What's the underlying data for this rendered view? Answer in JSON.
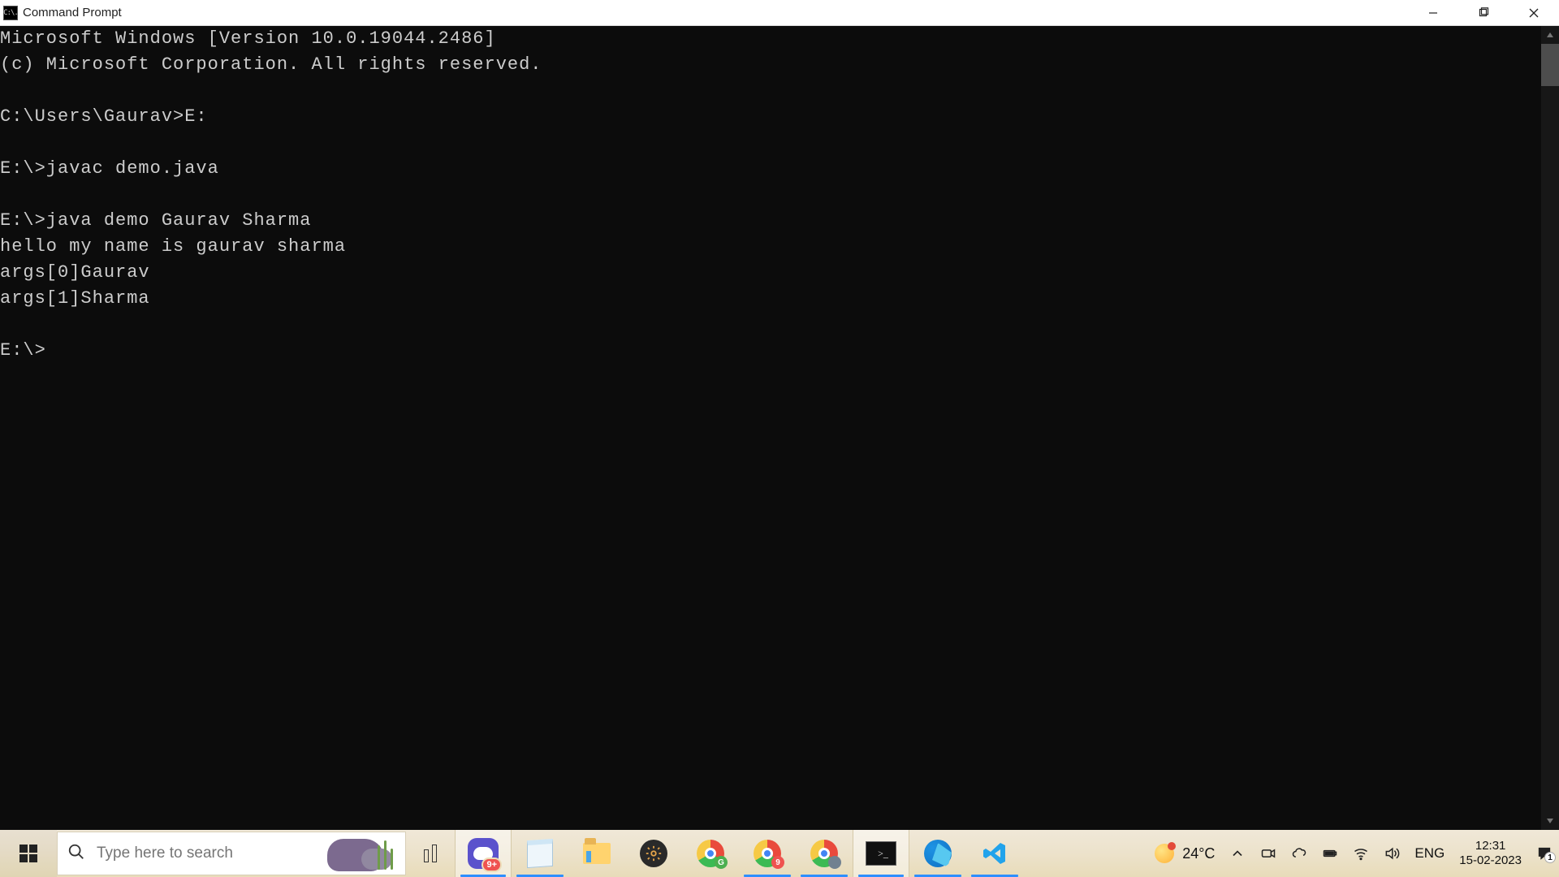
{
  "window": {
    "title": "Command Prompt",
    "icon_text": "C:\\."
  },
  "console": {
    "lines": [
      "Microsoft Windows [Version 10.0.19044.2486]",
      "(c) Microsoft Corporation. All rights reserved.",
      "",
      "C:\\Users\\Gaurav>E:",
      "",
      "E:\\>javac demo.java",
      "",
      "E:\\>java demo Gaurav Sharma",
      "hello my name is gaurav sharma",
      "args[0]Gaurav",
      "args[1]Sharma",
      "",
      "E:\\>"
    ]
  },
  "taskbar": {
    "search_placeholder": "Type here to search",
    "discord_badge": "9+",
    "chrome_badge1": "G",
    "chrome_badge2": "9",
    "cmd_prompt_glyph": ">_",
    "weather_temp": "24°C",
    "lang": "ENG",
    "time": "12:31",
    "date": "15-02-2023",
    "notif_count": "1"
  }
}
